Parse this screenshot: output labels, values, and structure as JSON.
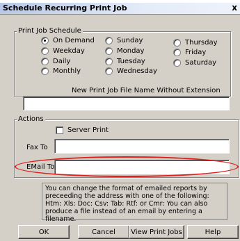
{
  "window": {
    "title": "Schedule Recurring Print Job",
    "close_glyph": "x"
  },
  "schedule": {
    "group_label": "Print Job Schedule",
    "options": {
      "on_demand": "On Demand",
      "weekday": "Weekday",
      "daily": "Daily",
      "monthly": "Monthly",
      "sunday": "Sunday",
      "monday": "Monday",
      "tuesday": "Tuesday",
      "wednesday": "Wednesday",
      "thursday": "Thursday",
      "friday": "Friday",
      "saturday": "Saturday"
    },
    "selected": "On Demand"
  },
  "filename": {
    "label": "New Print Job File Name Without Extension",
    "value": ""
  },
  "actions": {
    "group_label": "Actions",
    "server_print_label": "Server Print",
    "server_print_checked": false,
    "fax_label": "Fax To",
    "fax_value": "",
    "email_label": "EMail To",
    "email_value": ""
  },
  "info_text": "You can change the format of emailed reports by preceeding the address with one of the following: Htm: Xls: Doc: Csv: Tab: Rtf: or Cmr: You can also produce a file instead of an email by entering a filename.",
  "buttons": {
    "ok": "OK",
    "cancel": "Cancel",
    "view_print_jobs": "View Print Jobs",
    "help": "Help"
  },
  "colors": {
    "highlight": "#e02020"
  }
}
